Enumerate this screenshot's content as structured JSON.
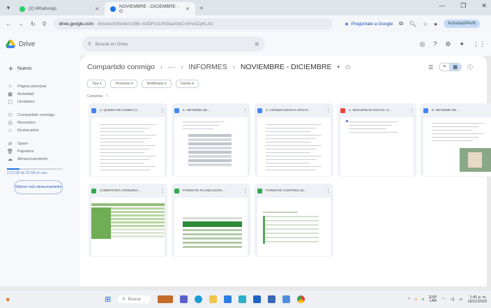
{
  "browser": {
    "tabs": [
      {
        "label": "(2) WhatsApp",
        "active": false,
        "favicon_color": "#25d366"
      },
      {
        "label": "NOVIEMBRE - DICIEMBRE - G",
        "active": true,
        "favicon_color": "#1a73e8"
      }
    ],
    "url_prefix": "drive.google.com",
    "url_path": "/drive/u/0/folders/1Bk-m3DFoI1zN3kaA0yCrvPw0ZpKLAz",
    "gemini_label": "Pregúntale a Google",
    "profile_label": "Actividad/Perfil"
  },
  "drive": {
    "app_name": "Drive",
    "search_placeholder": "Buscar en Drive",
    "new_label": "Nuevo",
    "nav_groups": [
      [
        {
          "icon": "⌂",
          "icon_name": "home-icon",
          "label": "Página principal"
        },
        {
          "icon": "▦",
          "icon_name": "activity-icon",
          "label": "Actividad"
        },
        {
          "icon": "▢",
          "icon_name": "workspaces-icon",
          "label": "Unidades"
        }
      ],
      [
        {
          "icon": "⚇",
          "icon_name": "shared-icon",
          "label": "Compartido conmigo"
        },
        {
          "icon": "◷",
          "icon_name": "recent-icon",
          "label": "Recientes"
        },
        {
          "icon": "☆",
          "icon_name": "star-icon",
          "label": "Destacados"
        }
      ],
      [
        {
          "icon": "⊘",
          "icon_name": "spam-icon",
          "label": "Spam"
        },
        {
          "icon": "🗑",
          "icon_name": "trash-icon",
          "label": "Papelera"
        },
        {
          "icon": "☁",
          "icon_name": "cloud-icon",
          "label": "Almacenamiento"
        }
      ]
    ],
    "storage_used": 0.22,
    "storage_text": "2,13 GB de 15 GB en uso",
    "get_more_label": "Obtener más almacenamiento",
    "breadcrumb": [
      "Compartido conmigo",
      "···",
      "INFORMES",
      "NOVIEMBRE - DICIEMBRE"
    ],
    "filters": [
      "Tipo",
      "Personas",
      "Modificado",
      "Fuente"
    ],
    "section_label": "Carpetas",
    "files": [
      {
        "title": "1. QUEMA DE GOBIO (T...",
        "color": "#4285f4",
        "thumb": "doc"
      },
      {
        "title": "2. INFORME DE...",
        "color": "#4285f4",
        "thumb": "doc-table"
      },
      {
        "title": "3. CONSECUENCIA APGAT...",
        "color": "#4285f4",
        "thumb": "doc"
      },
      {
        "title": "4. SEGURIDAD SOCIAL O...",
        "color": "#ea4335",
        "thumb": "pdf"
      },
      {
        "title": "5. INFORME DE...",
        "color": "#4285f4",
        "thumb": "photo"
      },
      {
        "title": "COBERTURA ATENDIDA...",
        "color": "#34a853",
        "thumb": "sheet-green"
      },
      {
        "title": "FORMATO PLANEACIÓN...",
        "color": "#34a853",
        "thumb": "sheet-banner"
      },
      {
        "title": "FORMATO CONTROL DI...",
        "color": "#34a853",
        "thumb": "sheet-light"
      }
    ]
  },
  "taskbar": {
    "search_placeholder": "Buscar",
    "lang_top": "ESP",
    "lang_bottom": "LAA",
    "time": "1:41 p. m.",
    "date": "15/12/2023"
  }
}
